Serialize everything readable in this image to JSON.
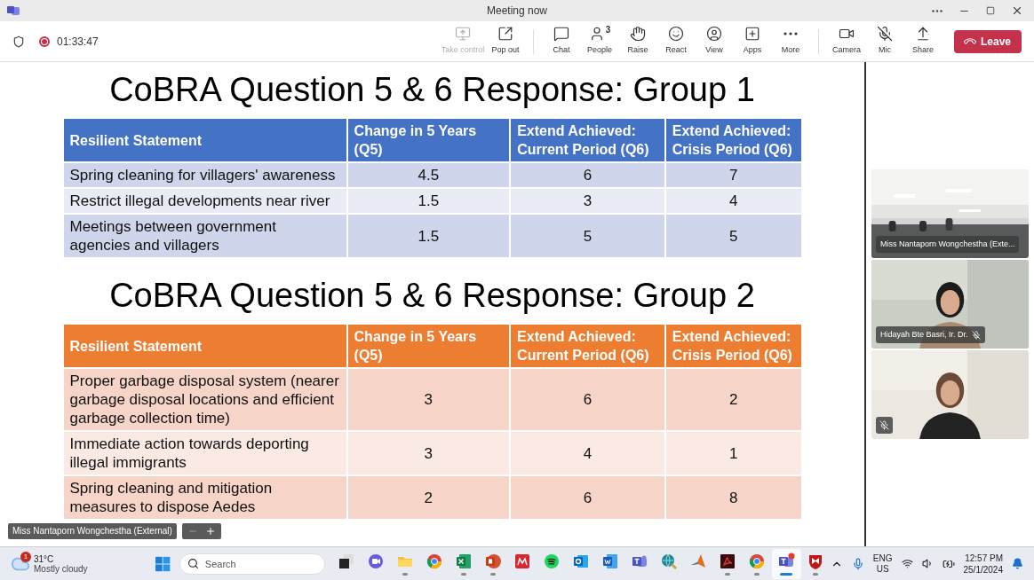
{
  "window": {
    "title": "Meeting now"
  },
  "meeting": {
    "recording": true,
    "timer": "01:33:47"
  },
  "toolbar": [
    {
      "kind": "take-control",
      "label": "Take control",
      "disabled": true
    },
    {
      "kind": "pop-out",
      "label": "Pop out",
      "disabled": false
    },
    {
      "kind": "chat",
      "label": "Chat",
      "disabled": false
    },
    {
      "kind": "people",
      "label": "People",
      "count": "3",
      "disabled": false
    },
    {
      "kind": "raise",
      "label": "Raise",
      "disabled": false
    },
    {
      "kind": "react",
      "label": "React",
      "disabled": false
    },
    {
      "kind": "view",
      "label": "View",
      "disabled": false
    },
    {
      "kind": "apps",
      "label": "Apps",
      "disabled": false
    },
    {
      "kind": "more",
      "label": "More",
      "disabled": false
    },
    {
      "kind": "camera",
      "label": "Camera",
      "disabled": false
    },
    {
      "kind": "mic",
      "label": "Mic",
      "disabled": false
    },
    {
      "kind": "share",
      "label": "Share",
      "disabled": false
    }
  ],
  "leave_button": "Leave",
  "slide": {
    "tables": [
      {
        "title": "CoBRA Question 5 & 6 Response: Group 1",
        "kind": "blue",
        "columns": [
          "Resilient Statement",
          "Change in 5 Years (Q5)",
          "Extend Achieved: Current Period (Q6)",
          "Extend Achieved: Crisis Period (Q6)"
        ],
        "rows": [
          [
            "Spring cleaning for villagers' awareness",
            "4.5",
            "6",
            "7"
          ],
          [
            "Restrict illegal developments near river",
            "1.5",
            "3",
            "4"
          ],
          [
            "Meetings between government agencies and villagers",
            "1.5",
            "5",
            "5"
          ]
        ]
      },
      {
        "title": "CoBRA Question 5 & 6 Response: Group 2",
        "kind": "orange",
        "columns": [
          "Resilient Statement",
          "Change in 5 Years (Q5)",
          "Extend Achieved: Current Period (Q6)",
          "Extend Achieved: Crisis Period (Q6)"
        ],
        "rows": [
          [
            "Proper garbage disposal system (nearer garbage disposal locations and efficient garbage collection time)",
            "3",
            "6",
            "2"
          ],
          [
            "Immediate action towards deporting illegal immigrants",
            "3",
            "4",
            "1"
          ],
          [
            "Spring cleaning and mitigation measures to dispose Aedes",
            "2",
            "6",
            "8"
          ]
        ]
      }
    ],
    "presenter_label": "Miss Nantaporn Wongchestha (External)"
  },
  "participants": [
    {
      "name": "Miss Nantaporn Wongchestha (Exte...",
      "muted": false,
      "kind": "room"
    },
    {
      "name": "Hidayah Bte Basri, Ir. Dr.",
      "muted": true,
      "kind": "person"
    },
    {
      "muted": true,
      "kind": "person"
    }
  ],
  "taskbar": {
    "weather": {
      "badge": "1",
      "temp": "31°C",
      "condition": "Mostly cloudy"
    },
    "search_placeholder": "Search",
    "apps": [
      {
        "kind": "task-view",
        "running": false,
        "selected": false
      },
      {
        "kind": "meet",
        "running": false,
        "selected": false
      },
      {
        "kind": "folder",
        "running": true,
        "selected": false
      },
      {
        "kind": "browser",
        "running": false,
        "selected": false
      },
      {
        "kind": "spreadsheet",
        "running": true,
        "selected": false
      },
      {
        "kind": "slides",
        "running": true,
        "selected": false
      },
      {
        "kind": "red-square",
        "running": false,
        "selected": false
      },
      {
        "kind": "music",
        "running": false,
        "selected": false
      },
      {
        "kind": "mail",
        "running": false,
        "selected": false
      },
      {
        "kind": "document",
        "running": false,
        "selected": false
      },
      {
        "kind": "team",
        "running": false,
        "selected": false
      },
      {
        "kind": "globe-search",
        "running": false,
        "selected": false
      },
      {
        "kind": "peak",
        "running": false,
        "selected": false
      },
      {
        "kind": "pdf",
        "running": true,
        "selected": false
      },
      {
        "kind": "browser",
        "running": true,
        "selected": false
      },
      {
        "kind": "team-new",
        "running": true,
        "selected": true
      },
      {
        "kind": "shield",
        "running": true,
        "selected": false
      }
    ],
    "language": "ENG",
    "region": "US",
    "time": "12:57 PM",
    "date": "25/1/2024"
  }
}
